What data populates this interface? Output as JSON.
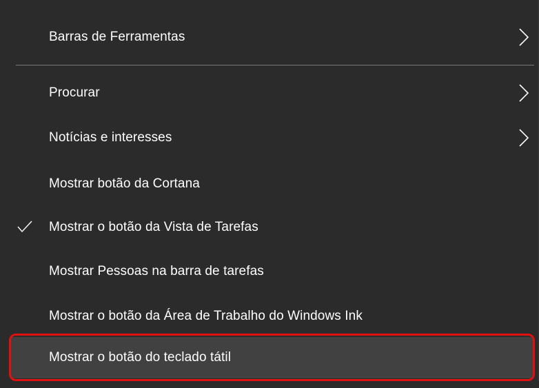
{
  "context_menu": {
    "items": [
      {
        "label": "Barras de Ferramentas",
        "has_submenu": true,
        "checked": false
      },
      {
        "label": "Procurar",
        "has_submenu": true,
        "checked": false
      },
      {
        "label": "Notícias e interesses",
        "has_submenu": true,
        "checked": false
      },
      {
        "label": "Mostrar botão da Cortana",
        "has_submenu": false,
        "checked": false
      },
      {
        "label": "Mostrar o botão da Vista de Tarefas",
        "has_submenu": false,
        "checked": true
      },
      {
        "label": "Mostrar Pessoas na barra de tarefas",
        "has_submenu": false,
        "checked": false
      },
      {
        "label": "Mostrar o botão da Área de Trabalho do Windows Ink",
        "has_submenu": false,
        "checked": false
      },
      {
        "label": "Mostrar o botão do teclado tátil",
        "has_submenu": false,
        "checked": false,
        "highlighted": true
      }
    ]
  },
  "colors": {
    "menu_background": "#2b2b2b",
    "hover_background": "#414141",
    "separator": "#7a7a7a",
    "text": "#ffffff",
    "annotation_outline": "#e01111"
  },
  "icons": {
    "submenu_arrow": "chevron-right-icon",
    "check": "checkmark-icon"
  }
}
